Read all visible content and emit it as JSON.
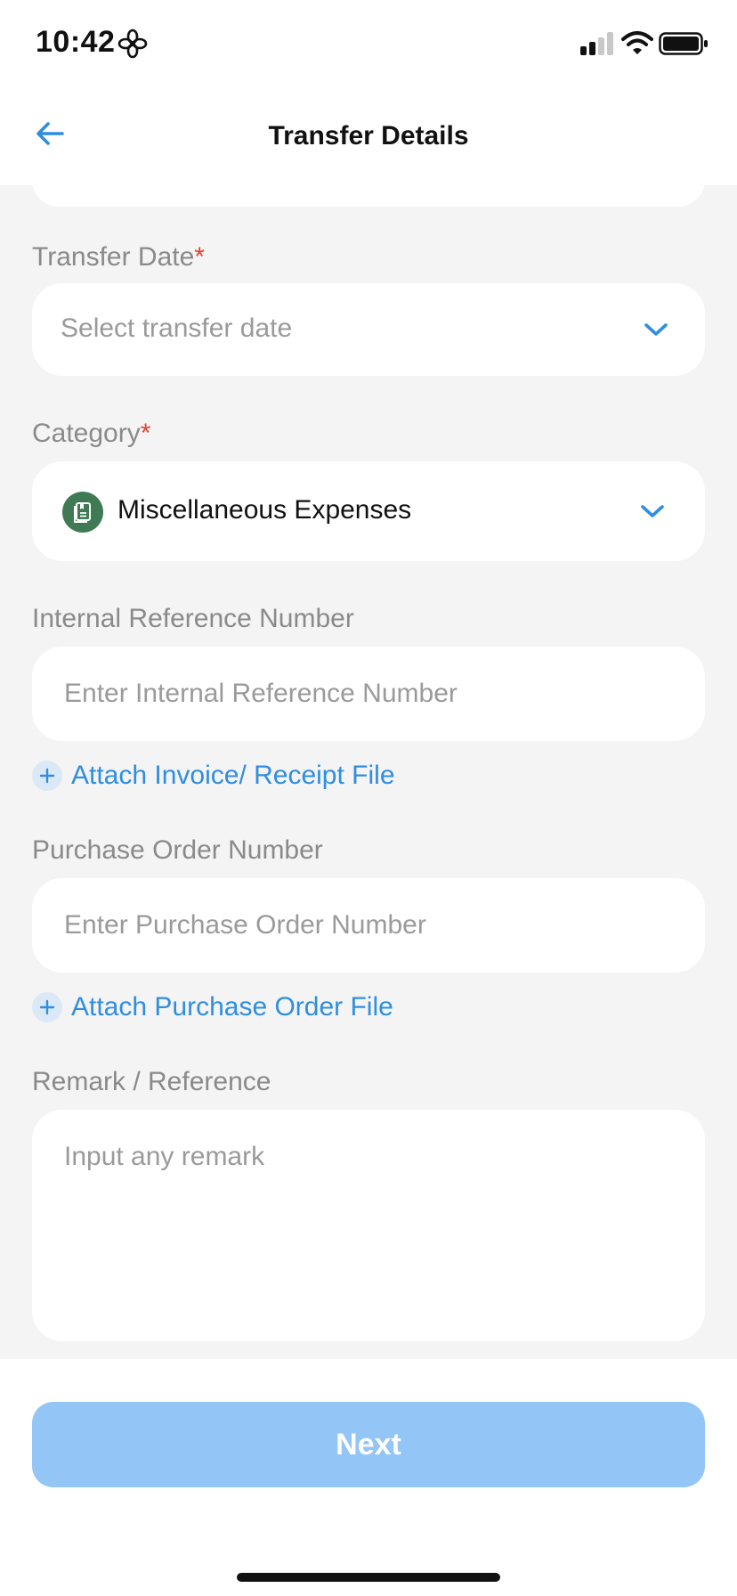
{
  "status_bar": {
    "time": "10:42",
    "icons": [
      "flower-icon",
      "signal-icon",
      "wifi-icon",
      "battery-icon"
    ]
  },
  "nav": {
    "title": "Transfer Details",
    "back_icon": "back-arrow-icon"
  },
  "form": {
    "transfer_date": {
      "label": "Transfer Date",
      "required_mark": "*",
      "placeholder": "Select transfer date"
    },
    "category": {
      "label": "Category",
      "required_mark": "*",
      "value": "Miscellaneous Expenses",
      "icon": "receipt-icon",
      "icon_color": "#3f7a55"
    },
    "internal_reference": {
      "label": "Internal Reference Number",
      "placeholder": "Enter Internal Reference Number",
      "attach_label": "Attach Invoice/ Receipt File"
    },
    "purchase_order": {
      "label": "Purchase Order Number",
      "placeholder": "Enter Purchase Order Number",
      "attach_label": "Attach Purchase Order File"
    },
    "remark": {
      "label": "Remark / Reference",
      "placeholder": "Input any remark"
    }
  },
  "actions": {
    "next_label": "Next"
  },
  "colors": {
    "accent": "#2f8ee0",
    "next_button_disabled": "#93c5f6",
    "required": "#e0452d",
    "form_background": "#f4f4f4"
  }
}
